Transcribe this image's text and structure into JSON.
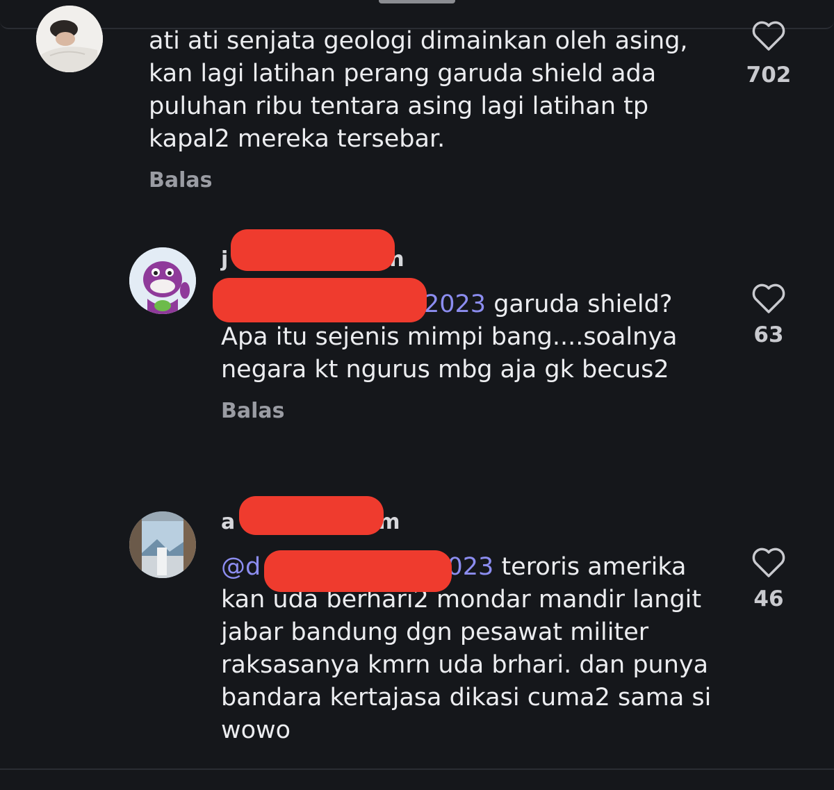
{
  "comments": [
    {
      "text": "ati ati senjata geologi dimainkan oleh asing, kan lagi latihan perang garuda shield ada puluhan ribu tentara asing lagi latihan tp kapal2 mereka tersebar.",
      "reply_label": "Balas",
      "likes": "702"
    },
    {
      "username_start": "j",
      "username_end": "n",
      "mention": "2023",
      "text": "garuda shield? Apa itu sejenis mimpi bang....soalnya negara kt ngurus mbg aja gk becus2",
      "reply_label": "Balas",
      "likes": "63"
    },
    {
      "username_start": "a",
      "username_end": "m",
      "mention_start": "@d",
      "mention_end": "2023",
      "text": "teroris amerika kan uda berhari2 mondar mandir langit jabar bandung dgn pesawat militer raksasanya kmrn uda brhari. dan punya bandara kertajasa dikasi cuma2 sama si wowo",
      "likes": "46"
    }
  ],
  "colors": {
    "background": "#15171b",
    "mention": "#8c8df0",
    "redaction": "#ef3b2e"
  }
}
